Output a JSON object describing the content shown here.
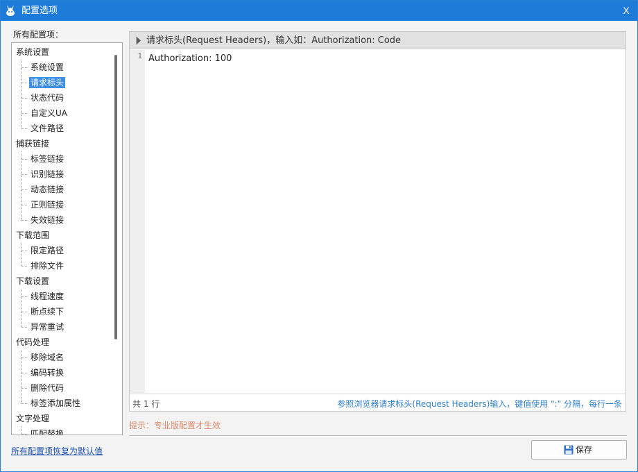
{
  "window": {
    "title": "配置选项",
    "close_label": "X"
  },
  "sidebar": {
    "label": "所有配置项：",
    "groups": [
      {
        "label": "系统设置",
        "items": [
          "系统设置",
          "请求标头",
          "状态代码",
          "自定义UA",
          "文件路径"
        ]
      },
      {
        "label": "捕获链接",
        "items": [
          "标签链接",
          "识别链接",
          "动态链接",
          "正则链接",
          "失效链接"
        ]
      },
      {
        "label": "下载范围",
        "items": [
          "限定路径",
          "排除文件"
        ]
      },
      {
        "label": "下载设置",
        "items": [
          "线程速度",
          "断点续下",
          "异常重试"
        ]
      },
      {
        "label": "代码处理",
        "items": [
          "移除域名",
          "编码转换",
          "删除代码",
          "标签添加属性"
        ]
      },
      {
        "label": "文字处理",
        "items": [
          "匹配替换"
        ]
      }
    ],
    "selected": "请求标头"
  },
  "panel": {
    "header": "请求标头(Request Headers)，输入如：Authorization: Code",
    "line_number": "1",
    "content": "Authorization: 100",
    "line_count": "共 1 行",
    "hint": "参照浏览器请求标头(Request Headers)输入，键值使用 \":\" 分隔，每行一条"
  },
  "pro_hint": "提示：专业版配置才生效",
  "footer": {
    "restore_link": "所有配置项恢复为默认值",
    "save_label": "保存"
  },
  "colors": {
    "titlebar": "#1e7bd8",
    "selection": "#3d8ee6",
    "hint_link": "#2f80d0",
    "pro_hint": "#d88a6a"
  }
}
